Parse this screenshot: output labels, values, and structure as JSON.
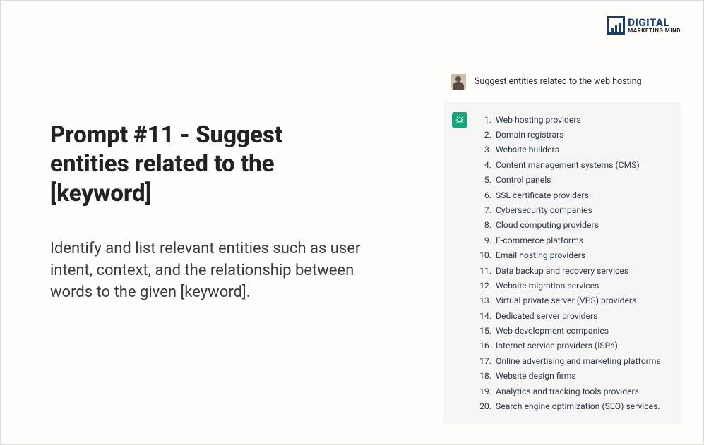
{
  "logo": {
    "line1": "DIGITAL",
    "line2": "MARKETING MIND"
  },
  "heading": "Prompt #11 - Suggest entities related to the [keyword]",
  "description": "Identify and list relevant entities such as user intent, context, and the relationship between words to the given [keyword].",
  "chat": {
    "user_prompt": "Suggest entities related to the web hosting",
    "assistant_items": [
      "Web hosting providers",
      "Domain registrars",
      "Website builders",
      "Content management systems (CMS)",
      "Control panels",
      "SSL certificate providers",
      "Cybersecurity companies",
      "Cloud computing providers",
      "E-commerce platforms",
      "Email hosting providers",
      "Data backup and recovery services",
      "Website migration services",
      "Virtual private server (VPS) providers",
      "Dedicated server providers",
      "Web development companies",
      "Internet service providers (ISPs)",
      "Online advertising and marketing platforms",
      "Website design firms",
      "Analytics and tracking tools providers",
      "Search engine optimization (SEO) services."
    ]
  }
}
